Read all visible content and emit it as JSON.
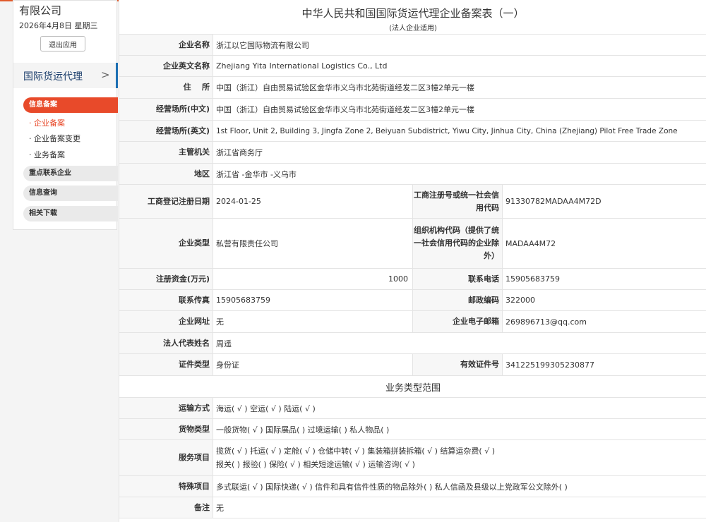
{
  "sidebar": {
    "company_tail": "有限公司",
    "date": "2026年4月8日 星期三",
    "logout_label": "退出应用",
    "main_menu": "国际货运代理",
    "main_menu_arrow": ">",
    "groups": {
      "info_filing": "信息备案",
      "key_contact": "重点联系企业",
      "info_query": "信息查询",
      "downloads": "相关下载"
    },
    "sub_items": {
      "enterprise_filing": "· 企业备案",
      "filing_change": "· 企业备案变更",
      "business_filing": "· 业务备案"
    }
  },
  "form": {
    "title": "中华人民共和国国际货运代理企业备案表（一）",
    "subtitle": "(法人企业适用)",
    "labels": {
      "name": "企业名称",
      "english_name": "企业英文名称",
      "address": "住    所",
      "business_place_cn": "经营场所(中文)",
      "business_place_en": "经营场所(英文)",
      "authority": "主管机关",
      "region": "地区",
      "reg_date": "工商登记注册日期",
      "credit_code": "工商注册号或统一社会信用代码",
      "ent_type": "企业类型",
      "org_code": "组织机构代码（提供了统一社会信用代码的企业除外）",
      "capital": "注册资金(万元)",
      "phone": "联系电话",
      "fax": "联系传真",
      "postcode": "邮政编码",
      "website": "企业网址",
      "email": "企业电子邮箱",
      "legal_rep": "法人代表姓名",
      "id_type": "证件类型",
      "id_number": "有效证件号",
      "transport": "运输方式",
      "cargo": "货物类型",
      "service": "服务项目",
      "special": "特殊项目",
      "remark": "备注"
    },
    "values": {
      "name": "浙江以它国际物流有限公司",
      "english_name": "Zhejiang Yita International Logistics Co., Ltd",
      "address": "中国（浙江）自由贸易试验区金华市义乌市北苑街道经发二区3幢2单元一楼",
      "business_place_cn": "中国（浙江）自由贸易试验区金华市义乌市北苑街道经发二区3幢2单元一楼",
      "business_place_en": "1st Floor, Unit 2, Building 3, Jingfa Zone 2, Beiyuan Subdistrict, Yiwu City, Jinhua City, China (Zhejiang) Pilot Free Trade Zone",
      "authority": "浙江省商务厅",
      "region": "浙江省 -金华市 -义乌市",
      "reg_date": "2024-01-25",
      "credit_code": "91330782MADAA4M72D",
      "ent_type": "私营有限责任公司",
      "org_code": "MADAA4M72",
      "capital": "1000",
      "phone": "15905683759",
      "fax": "15905683759",
      "postcode": "322000",
      "website": "无",
      "email": "269896713@qq.com",
      "legal_rep": "周遥",
      "id_type": "身份证",
      "id_number": "341225199305230877",
      "transport": "海运( √ ) 空运( √ ) 陆运( √ )",
      "cargo": "一般货物( √ ) 国际展品( ) 过境运输( ) 私人物品( )",
      "service_line1": "揽货( √ ) 托运( √ ) 定舱( √ ) 仓储中转( √ ) 集装箱拼装拆箱( √ ) 结算运杂费( √ )",
      "service_line2": "报关( ) 报验( ) 保险( √ ) 相关短途运输( √ ) 运输咨询( √ )",
      "special": "多式联运( √ ) 国际快递( √ ) 信件和具有信件性质的物品除外( ) 私人信函及县级以上党政军公文除外( )",
      "remark": "无"
    },
    "section_business_scope": "业务类型范围"
  }
}
